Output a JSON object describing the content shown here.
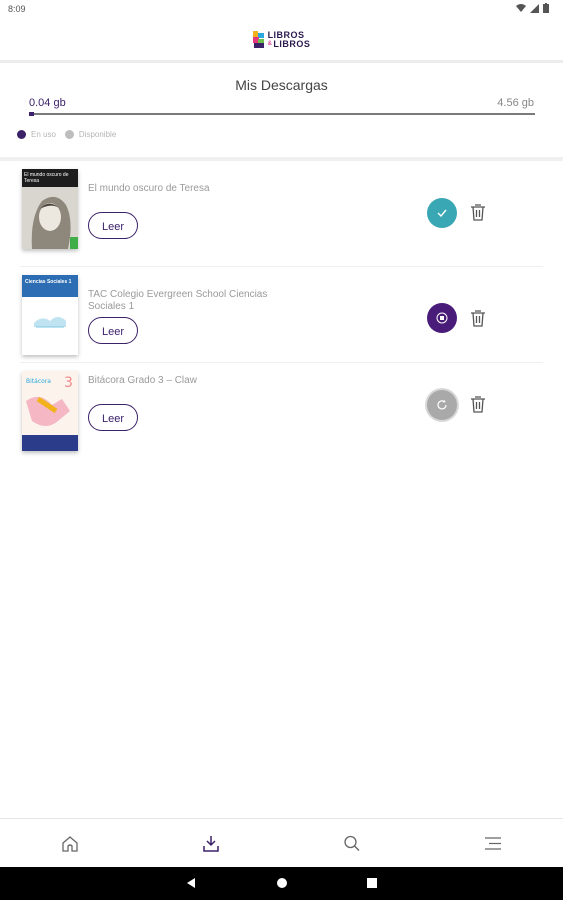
{
  "status_bar": {
    "time": "8:09"
  },
  "logo": {
    "line1": "LIBROS",
    "amp": "&",
    "line2": "LIBROS"
  },
  "downloads": {
    "title": "Mis Descargas",
    "used": "0.04 gb",
    "total": "4.56 gb",
    "used_fraction": 0.009,
    "legend": [
      {
        "label": "En uso",
        "color": "#3b2168"
      },
      {
        "label": "Disponible",
        "color": "#bdbdbd"
      }
    ]
  },
  "books": [
    {
      "title": "El mundo oscuro de Teresa",
      "read_label": "Leer",
      "status": "downloaded",
      "status_color": "#3aa7b4",
      "cover_title": "El mundo oscuro de Teresa"
    },
    {
      "title": "TAC Colegio Evergreen School Ciencias Sociales 1",
      "read_label": "Leer",
      "status": "downloading",
      "status_color": "#4a1c7a",
      "cover_title": "Ciencias Sociales 1"
    },
    {
      "title": "Bitácora Grado 3 – Claw",
      "read_label": "Leer",
      "status": "retry",
      "status_color": "#a9a9a9",
      "cover_title": "Bitácora"
    }
  ],
  "nav": {
    "items": [
      "home-icon",
      "download-icon",
      "search-icon",
      "menu-icon"
    ],
    "active": 1
  }
}
